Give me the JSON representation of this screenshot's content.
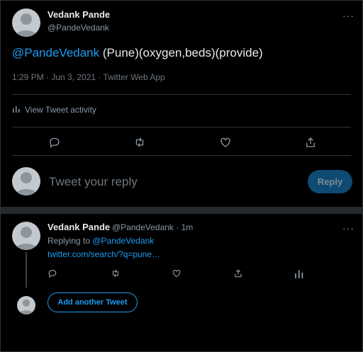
{
  "tweet": {
    "author_name": "Vedank Pande",
    "author_handle": "@PandeVedank",
    "mention": "@PandeVedank",
    "text_rest": " (Pune)(oxygen,beds)(provide)",
    "meta": "1:29 PM · Jun 3, 2021 · Twitter Web App",
    "activity_label": "View Tweet activity"
  },
  "more_glyph": "···",
  "reply_box": {
    "placeholder": "Tweet your reply",
    "button_label": "Reply"
  },
  "reply": {
    "author_name": "Vedank Pande",
    "author_handle_time": "@PandeVedank · 1m",
    "replying_prefix": "Replying to ",
    "replying_handle": "@PandeVedank",
    "link_text": "twitter.com/search/?q=pune…"
  },
  "add_tweet_label": "Add another Tweet",
  "icons": [
    "reply-icon",
    "retweet-icon",
    "like-icon",
    "share-icon",
    "activity-icon"
  ],
  "colors": {
    "accent": "#1d9bf0",
    "background": "#000000",
    "reply_button": "#0e4a73"
  }
}
